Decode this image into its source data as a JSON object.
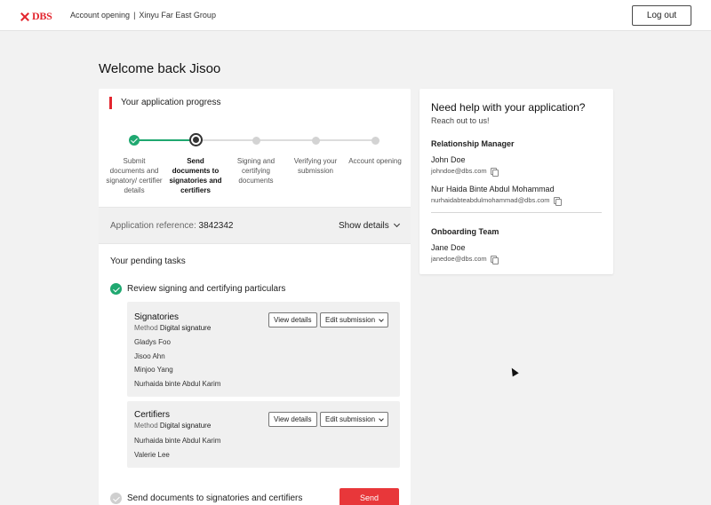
{
  "header": {
    "brand": "DBS",
    "context_left": "Account opening",
    "context_sep": "|",
    "context_right": "Xinyu Far East Group",
    "logout_label": "Log out"
  },
  "page": {
    "welcome": "Welcome back Jisoo"
  },
  "progress": {
    "title": "Your application progress",
    "steps": [
      {
        "label": "Submit documents and signatory/ certifier details",
        "status": "done"
      },
      {
        "label": "Send documents to signatories and certifiers",
        "status": "current"
      },
      {
        "label": "Signing and certifying documents",
        "status": "pending"
      },
      {
        "label": "Verifying your submission",
        "status": "pending"
      },
      {
        "label": "Account opening",
        "status": "pending"
      }
    ]
  },
  "reference": {
    "label": "Application reference:",
    "value": "3842342",
    "show_details": "Show details"
  },
  "tasks": {
    "title": "Your pending tasks",
    "review": {
      "label": "Review signing and certifying particulars",
      "signatories": {
        "title": "Signatories",
        "method_label": "Method",
        "method_value": "Digital signature",
        "view_label": "View details",
        "edit_label": "Edit submission",
        "names": [
          "Gladys Foo",
          "Jisoo Ahn",
          "Minjoo Yang",
          "Nurhaida binte Abdul Karim"
        ]
      },
      "certifiers": {
        "title": "Certifiers",
        "method_label": "Method",
        "method_value": "Digital signature",
        "view_label": "View details",
        "edit_label": "Edit submission",
        "names": [
          "Nurhaida binte Abdul Karim",
          "Valerie Lee"
        ]
      }
    },
    "send": {
      "label": "Send documents to signatories and certifiers",
      "button": "Send"
    }
  },
  "help": {
    "title": "Need help with your application?",
    "subtitle": "Reach out to us!",
    "rm_title": "Relationship Manager",
    "rm_contacts": [
      {
        "name": "John Doe",
        "email": "johndoe@dbs.com"
      },
      {
        "name": "Nur Haida Binte Abdul Mohammad",
        "email": "nurhaidabteabdulmohammad@dbs.com"
      }
    ],
    "onboarding_title": "Onboarding Team",
    "onboarding_contacts": [
      {
        "name": "Jane Doe",
        "email": "janedoe@dbs.com"
      }
    ]
  },
  "colors": {
    "brand_red": "#e3262f",
    "success_green": "#1fa870",
    "send_red": "#e8373a"
  }
}
